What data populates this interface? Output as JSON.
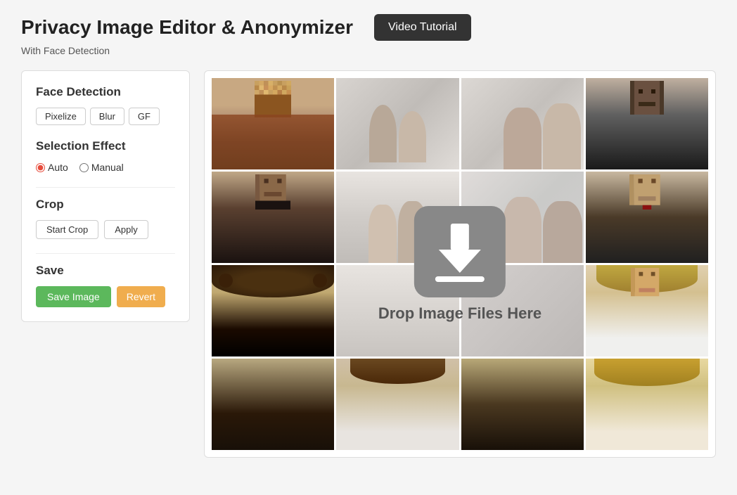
{
  "header": {
    "title": "Privacy Image Editor & Anonymizer",
    "subtitle": "With Face Detection",
    "tutorial_btn": "Video Tutorial"
  },
  "sidebar": {
    "face_detection_label": "Face Detection",
    "effect_buttons": [
      {
        "label": "Pixelize",
        "id": "pixelize"
      },
      {
        "label": "Blur",
        "id": "blur"
      },
      {
        "label": "GF",
        "id": "gf"
      }
    ],
    "selection_effect_label": "Selection Effect",
    "selection_options": [
      {
        "label": "Auto",
        "value": "auto",
        "checked": true
      },
      {
        "label": "Manual",
        "value": "manual",
        "checked": false
      }
    ],
    "crop_label": "Crop",
    "start_crop_label": "Start Crop",
    "apply_label": "Apply",
    "save_label": "Save",
    "save_image_label": "Save Image",
    "revert_label": "Revert"
  },
  "dropzone": {
    "drop_text": "Drop Image Files Here"
  }
}
